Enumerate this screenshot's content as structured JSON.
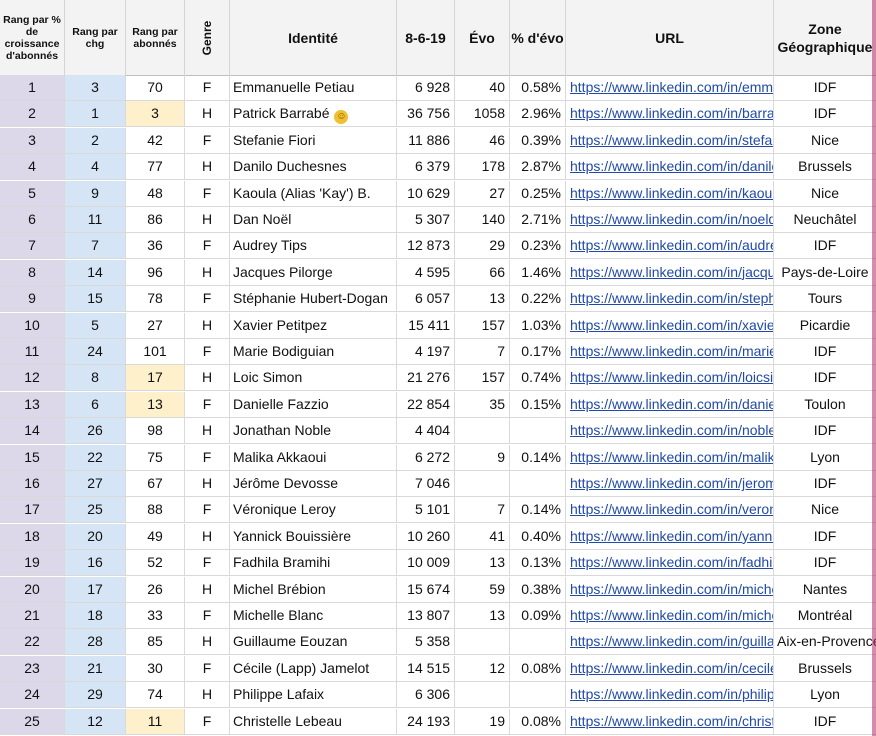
{
  "headers": {
    "rank_pct": "Rang par % de croissance d'abonnés",
    "rank_chg": "Rang par chg",
    "rank_abo": "Rang par abonnés",
    "genre": "Genre",
    "identite": "Identité",
    "date": "8-6-19",
    "evo": "Évo",
    "pct_evo": "% d'évo",
    "url": "URL",
    "zone": "Zone Géographique"
  },
  "colors": {
    "rank_bg": "#ddd7ea",
    "chg_bg": "#d5e5f5",
    "highlight_bg": "#fdf0cb",
    "link": "#2049a8"
  },
  "rows": [
    {
      "rank": "1",
      "chg": "3",
      "abo": "70",
      "abo_hl": false,
      "genre": "F",
      "name": "Emmanuelle Petiau",
      "badge": false,
      "followers": "6 928",
      "evo": "40",
      "pct": "0.58%",
      "url": "https://www.linkedin.com/in/emman",
      "zone": "IDF"
    },
    {
      "rank": "2",
      "chg": "1",
      "abo": "3",
      "abo_hl": true,
      "genre": "H",
      "name": "Patrick Barrabé",
      "badge": true,
      "followers": "36 756",
      "evo": "1058",
      "pct": "2.96%",
      "url": "https://www.linkedin.com/in/barrabe",
      "zone": "IDF"
    },
    {
      "rank": "3",
      "chg": "2",
      "abo": "42",
      "abo_hl": false,
      "genre": "F",
      "name": "Stefanie Fiori",
      "badge": false,
      "followers": "11 886",
      "evo": "46",
      "pct": "0.39%",
      "url": "https://www.linkedin.com/in/stefanie",
      "zone": "Nice"
    },
    {
      "rank": "4",
      "chg": "4",
      "abo": "77",
      "abo_hl": false,
      "genre": "H",
      "name": "Danilo Duchesnes",
      "badge": false,
      "followers": "6 379",
      "evo": "178",
      "pct": "2.87%",
      "url": "https://www.linkedin.com/in/danilodu",
      "zone": "Brussels"
    },
    {
      "rank": "5",
      "chg": "9",
      "abo": "48",
      "abo_hl": false,
      "genre": "F",
      "name": "Kaoula (Alias 'Kay') B.",
      "badge": false,
      "followers": "10 629",
      "evo": "27",
      "pct": "0.25%",
      "url": "https://www.linkedin.com/in/kaoulak",
      "zone": "Nice"
    },
    {
      "rank": "6",
      "chg": "11",
      "abo": "86",
      "abo_hl": false,
      "genre": "H",
      "name": "Dan Noël",
      "badge": false,
      "followers": "5 307",
      "evo": "140",
      "pct": "2.71%",
      "url": "https://www.linkedin.com/in/noeldar",
      "zone": "Neuchâtel"
    },
    {
      "rank": "7",
      "chg": "7",
      "abo": "36",
      "abo_hl": false,
      "genre": "F",
      "name": "Audrey Tips",
      "badge": false,
      "followers": "12 873",
      "evo": "29",
      "pct": "0.23%",
      "url": "https://www.linkedin.com/in/audreyt",
      "zone": "IDF"
    },
    {
      "rank": "8",
      "chg": "14",
      "abo": "96",
      "abo_hl": false,
      "genre": "H",
      "name": "Jacques Pilorge",
      "badge": false,
      "followers": "4 595",
      "evo": "66",
      "pct": "1.46%",
      "url": "https://www.linkedin.com/in/jacques",
      "zone": "Pays-de-Loire"
    },
    {
      "rank": "9",
      "chg": "15",
      "abo": "78",
      "abo_hl": false,
      "genre": "F",
      "name": "Stéphanie Hubert-Dogan",
      "badge": false,
      "followers": "6 057",
      "evo": "13",
      "pct": "0.22%",
      "url": "https://www.linkedin.com/in/stephar",
      "zone": "Tours"
    },
    {
      "rank": "10",
      "chg": "5",
      "abo": "27",
      "abo_hl": false,
      "genre": "H",
      "name": "Xavier Petitpez",
      "badge": false,
      "followers": "15 411",
      "evo": "157",
      "pct": "1.03%",
      "url": "https://www.linkedin.com/in/xavier-p",
      "zone": "Picardie"
    },
    {
      "rank": "11",
      "chg": "24",
      "abo": "101",
      "abo_hl": false,
      "genre": "F",
      "name": "Marie Bodiguian",
      "badge": false,
      "followers": "4 197",
      "evo": "7",
      "pct": "0.17%",
      "url": "https://www.linkedin.com/in/mariebo",
      "zone": "IDF"
    },
    {
      "rank": "12",
      "chg": "8",
      "abo": "17",
      "abo_hl": true,
      "genre": "H",
      "name": "Loic Simon",
      "badge": false,
      "followers": "21 276",
      "evo": "157",
      "pct": "0.74%",
      "url": "https://www.linkedin.com/in/loicsimo",
      "zone": "IDF"
    },
    {
      "rank": "13",
      "chg": "6",
      "abo": "13",
      "abo_hl": true,
      "genre": "F",
      "name": "Danielle Fazzio",
      "badge": false,
      "followers": "22 854",
      "evo": "35",
      "pct": "0.15%",
      "url": "https://www.linkedin.com/in/danielle",
      "zone": "Toulon"
    },
    {
      "rank": "14",
      "chg": "26",
      "abo": "98",
      "abo_hl": false,
      "genre": "H",
      "name": "Jonathan Noble",
      "badge": false,
      "followers": "4 404",
      "evo": "",
      "pct": "",
      "url": "https://www.linkedin.com/in/noblejor",
      "zone": "IDF"
    },
    {
      "rank": "15",
      "chg": "22",
      "abo": "75",
      "abo_hl": false,
      "genre": "F",
      "name": "Malika Akkaoui",
      "badge": false,
      "followers": "6 272",
      "evo": "9",
      "pct": "0.14%",
      "url": "https://www.linkedin.com/in/malika-a",
      "zone": "Lyon"
    },
    {
      "rank": "16",
      "chg": "27",
      "abo": "67",
      "abo_hl": false,
      "genre": "H",
      "name": "Jérôme Devosse",
      "badge": false,
      "followers": "7 046",
      "evo": "",
      "pct": "",
      "url": "https://www.linkedin.com/in/jerome",
      "zone": "IDF"
    },
    {
      "rank": "17",
      "chg": "25",
      "abo": "88",
      "abo_hl": false,
      "genre": "F",
      "name": "Véronique Leroy",
      "badge": false,
      "followers": "5 101",
      "evo": "7",
      "pct": "0.14%",
      "url": "https://www.linkedin.com/in/veroniq",
      "zone": "Nice"
    },
    {
      "rank": "18",
      "chg": "20",
      "abo": "49",
      "abo_hl": false,
      "genre": "H",
      "name": "Yannick Bouissière",
      "badge": false,
      "followers": "10 260",
      "evo": "41",
      "pct": "0.40%",
      "url": "https://www.linkedin.com/in/yannick",
      "zone": "IDF"
    },
    {
      "rank": "19",
      "chg": "16",
      "abo": "52",
      "abo_hl": false,
      "genre": "F",
      "name": "Fadhila Bramihi",
      "badge": false,
      "followers": "10 009",
      "evo": "13",
      "pct": "0.13%",
      "url": "https://www.linkedin.com/in/fadhilab",
      "zone": "IDF"
    },
    {
      "rank": "20",
      "chg": "17",
      "abo": "26",
      "abo_hl": false,
      "genre": "H",
      "name": "Michel Brébion",
      "badge": false,
      "followers": "15 674",
      "evo": "59",
      "pct": "0.38%",
      "url": "https://www.linkedin.com/in/michelb",
      "zone": "Nantes"
    },
    {
      "rank": "21",
      "chg": "18",
      "abo": "33",
      "abo_hl": false,
      "genre": "F",
      "name": "Michelle Blanc",
      "badge": false,
      "followers": "13 807",
      "evo": "13",
      "pct": "0.09%",
      "url": "https://www.linkedin.com/in/michelle",
      "zone": "Montréal"
    },
    {
      "rank": "22",
      "chg": "28",
      "abo": "85",
      "abo_hl": false,
      "genre": "H",
      "name": "Guillaume Eouzan",
      "badge": false,
      "followers": "5 358",
      "evo": "",
      "pct": "",
      "url": "https://www.linkedin.com/in/guillaum",
      "zone": "Aix-en-Provence"
    },
    {
      "rank": "23",
      "chg": "21",
      "abo": "30",
      "abo_hl": false,
      "genre": "F",
      "name": "Cécile (Lapp) Jamelot",
      "badge": false,
      "followers": "14 515",
      "evo": "12",
      "pct": "0.08%",
      "url": "https://www.linkedin.com/in/cecileja",
      "zone": "Brussels"
    },
    {
      "rank": "24",
      "chg": "29",
      "abo": "74",
      "abo_hl": false,
      "genre": "H",
      "name": "Philippe Lafaix",
      "badge": false,
      "followers": "6 306",
      "evo": "",
      "pct": "",
      "url": "https://www.linkedin.com/in/philippe",
      "zone": "Lyon"
    },
    {
      "rank": "25",
      "chg": "12",
      "abo": "11",
      "abo_hl": true,
      "genre": "F",
      "name": "Christelle Lebeau",
      "badge": false,
      "followers": "24 193",
      "evo": "19",
      "pct": "0.08%",
      "url": "https://www.linkedin.com/in/christell",
      "zone": "IDF"
    }
  ]
}
